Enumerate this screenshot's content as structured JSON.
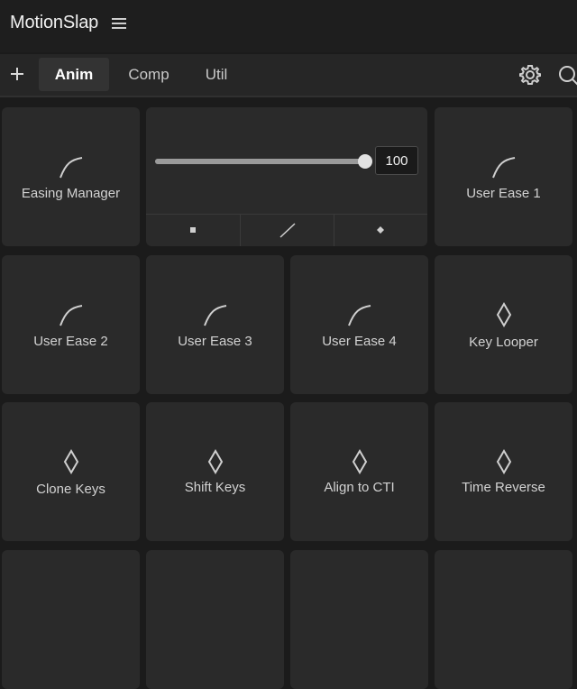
{
  "app": {
    "title": "MotionSlap"
  },
  "tabs": [
    {
      "label": "Anim",
      "active": true
    },
    {
      "label": "Comp",
      "active": false
    },
    {
      "label": "Util",
      "active": false
    }
  ],
  "slider": {
    "value": "100",
    "level": 1.0
  },
  "tiles": {
    "easing_manager": "Easing Manager",
    "user_ease_1": "User Ease 1",
    "user_ease_2": "User Ease 2",
    "user_ease_3": "User Ease 3",
    "user_ease_4": "User Ease 4",
    "key_looper": "Key Looper",
    "clone_keys": "Clone Keys",
    "shift_keys": "Shift Keys",
    "align_to_cti": "Align to CTI",
    "time_reverse": "Time Reverse"
  },
  "icons": {
    "menu": "hamburger-icon",
    "add": "plus-icon",
    "settings": "gear-icon",
    "search": "search-icon",
    "ease": "ease-curve-icon",
    "keyframe": "diamond-icon"
  }
}
